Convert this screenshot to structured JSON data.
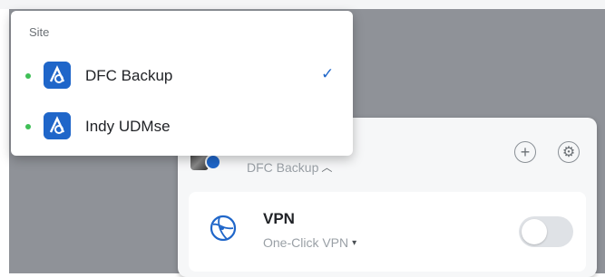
{
  "site_menu": {
    "label": "Site",
    "items": [
      {
        "name": "DFC Backup",
        "status": "online",
        "selected": true
      },
      {
        "name": "Indy UDMse",
        "status": "online",
        "selected": false
      }
    ],
    "check_glyph": "✓"
  },
  "header": {
    "current_site": "DFC Backup",
    "chevron_glyph": "︿",
    "add_glyph": "+",
    "settings_glyph": "⚙"
  },
  "vpn": {
    "title": "VPN",
    "subtitle": "One-Click VPN",
    "subtitle_chevron": "▾",
    "enabled": false
  },
  "colors": {
    "accent": "#1f66c9",
    "status_online": "#3fbf56",
    "backdrop": "#8f9298"
  }
}
